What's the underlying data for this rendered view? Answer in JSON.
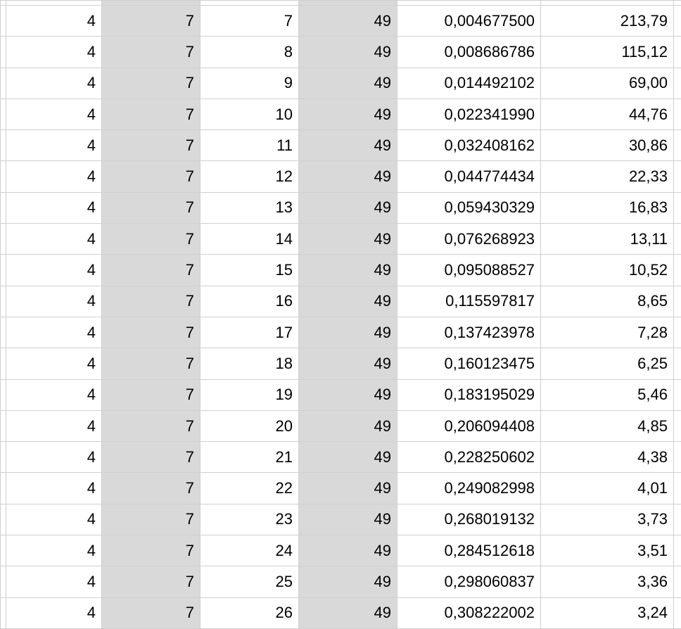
{
  "rows": [
    {
      "c0": "4",
      "c1": "7",
      "c2": "7",
      "c3": "49",
      "c4": "0,004677500",
      "c5": "213,79"
    },
    {
      "c0": "4",
      "c1": "7",
      "c2": "8",
      "c3": "49",
      "c4": "0,008686786",
      "c5": "115,12"
    },
    {
      "c0": "4",
      "c1": "7",
      "c2": "9",
      "c3": "49",
      "c4": "0,014492102",
      "c5": "69,00"
    },
    {
      "c0": "4",
      "c1": "7",
      "c2": "10",
      "c3": "49",
      "c4": "0,022341990",
      "c5": "44,76"
    },
    {
      "c0": "4",
      "c1": "7",
      "c2": "11",
      "c3": "49",
      "c4": "0,032408162",
      "c5": "30,86"
    },
    {
      "c0": "4",
      "c1": "7",
      "c2": "12",
      "c3": "49",
      "c4": "0,044774434",
      "c5": "22,33"
    },
    {
      "c0": "4",
      "c1": "7",
      "c2": "13",
      "c3": "49",
      "c4": "0,059430329",
      "c5": "16,83"
    },
    {
      "c0": "4",
      "c1": "7",
      "c2": "14",
      "c3": "49",
      "c4": "0,076268923",
      "c5": "13,11"
    },
    {
      "c0": "4",
      "c1": "7",
      "c2": "15",
      "c3": "49",
      "c4": "0,095088527",
      "c5": "10,52"
    },
    {
      "c0": "4",
      "c1": "7",
      "c2": "16",
      "c3": "49",
      "c4": "0,115597817",
      "c5": "8,65"
    },
    {
      "c0": "4",
      "c1": "7",
      "c2": "17",
      "c3": "49",
      "c4": "0,137423978",
      "c5": "7,28"
    },
    {
      "c0": "4",
      "c1": "7",
      "c2": "18",
      "c3": "49",
      "c4": "0,160123475",
      "c5": "6,25"
    },
    {
      "c0": "4",
      "c1": "7",
      "c2": "19",
      "c3": "49",
      "c4": "0,183195029",
      "c5": "5,46"
    },
    {
      "c0": "4",
      "c1": "7",
      "c2": "20",
      "c3": "49",
      "c4": "0,206094408",
      "c5": "4,85"
    },
    {
      "c0": "4",
      "c1": "7",
      "c2": "21",
      "c3": "49",
      "c4": "0,228250602",
      "c5": "4,38"
    },
    {
      "c0": "4",
      "c1": "7",
      "c2": "22",
      "c3": "49",
      "c4": "0,249082998",
      "c5": "4,01"
    },
    {
      "c0": "4",
      "c1": "7",
      "c2": "23",
      "c3": "49",
      "c4": "0,268019132",
      "c5": "3,73"
    },
    {
      "c0": "4",
      "c1": "7",
      "c2": "24",
      "c3": "49",
      "c4": "0,284512618",
      "c5": "3,51"
    },
    {
      "c0": "4",
      "c1": "7",
      "c2": "25",
      "c3": "49",
      "c4": "0,298060837",
      "c5": "3,36"
    },
    {
      "c0": "4",
      "c1": "7",
      "c2": "26",
      "c3": "49",
      "c4": "0,308222002",
      "c5": "3,24"
    }
  ]
}
